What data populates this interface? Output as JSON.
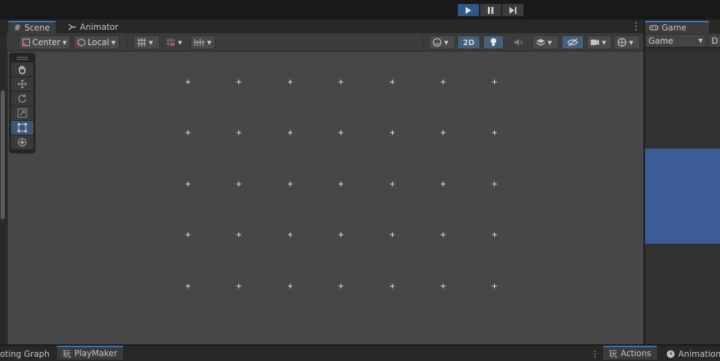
{
  "playbar": {
    "buttons": [
      {
        "name": "play",
        "icon": "play-icon",
        "active": true
      },
      {
        "name": "pause",
        "icon": "pause-icon",
        "active": false
      },
      {
        "name": "step",
        "icon": "step-icon",
        "active": false
      }
    ]
  },
  "tabs": {
    "scene": "Scene",
    "animator": "Animator",
    "game": "Game"
  },
  "scene_toolbar": {
    "pivot_mode": "Center",
    "pivot_rotation": "Local",
    "toggle_2d": "2D"
  },
  "game_toolbar": {
    "display_select": "Game",
    "partial_select": "D"
  },
  "tool_palette": [
    {
      "name": "hand-tool",
      "icon": "hand-icon",
      "active": false
    },
    {
      "name": "move-tool",
      "icon": "move-arrows-icon",
      "active": false
    },
    {
      "name": "rotate-tool",
      "icon": "rotate-icon",
      "active": false
    },
    {
      "name": "scale-tool",
      "icon": "scale-icon",
      "active": false
    },
    {
      "name": "rect-tool",
      "icon": "rect-transform-icon",
      "active": true
    },
    {
      "name": "transform-tool",
      "icon": "transform-icon",
      "active": false
    }
  ],
  "bottom_tabs": {
    "visual_scripting": "oting Graph",
    "playmaker": "PlayMaker",
    "actions": "Actions",
    "animation": "Animation"
  },
  "colors": {
    "accent": "#3a79bb",
    "play_active": "#2d5a8c",
    "scene_bg": "#474747",
    "game_blue": "#3b5c96"
  }
}
